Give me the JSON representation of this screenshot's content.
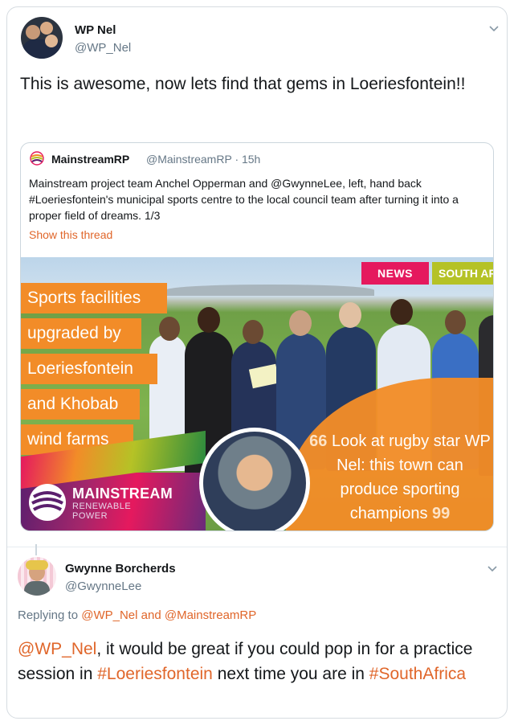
{
  "tweet": {
    "author_name": "WP Nel",
    "author_handle": "@WP_Nel",
    "text": "This is awesome, now lets find that gems in Loeriesfontein!!",
    "menu_icon": "chevron-down-icon"
  },
  "quoted_tweet": {
    "author_name": "MainstreamRP",
    "author_handle": "@MainstreamRP",
    "time": "· 15h",
    "text": "Mainstream project team Anchel Opperman and @GwynneLee, left, hand back #Loeriesfontein's municipal sports centre to the local council team after turning it into a proper field of dreams. 1/3",
    "show_thread": "Show this thread",
    "image": {
      "tag_news": "NEWS",
      "tag_region": "SOUTH AF",
      "headline_lines": [
        "Sports facilities",
        "upgraded by",
        "Loeriesfontein",
        "and Khobab",
        "wind farms"
      ],
      "quote_open": "66",
      "quote_text": "Look at rugby star WP Nel: this town can produce sporting champions",
      "quote_close": "99",
      "brand_name": "MAINSTREAM",
      "brand_sub1": "RENEWABLE",
      "brand_sub2": "POWER",
      "colors": {
        "orange": "#f28c28",
        "pink": "#e5195e",
        "lime": "#b5c226",
        "purple": "#5b1f6e"
      }
    }
  },
  "reply": {
    "author_name": "Gwynne Borcherds",
    "author_handle": "@GwynneLee",
    "replying_prefix": "Replying to",
    "replying_user1": "@WP_Nel",
    "replying_and": "and",
    "replying_user2": "@MainstreamRP",
    "mention": "@WP_Nel",
    "text_part1": ", it would be great if you could pop in for a practice session in",
    "hashtag1": "#Loeriesfontein",
    "text_part2": "next time you are in",
    "hashtag2": "#SouthAfrica",
    "menu_icon": "chevron-down-icon"
  },
  "colors": {
    "link": "#e0662a",
    "text": "#14171a",
    "muted": "#657786",
    "border": "#ccd6dd"
  }
}
